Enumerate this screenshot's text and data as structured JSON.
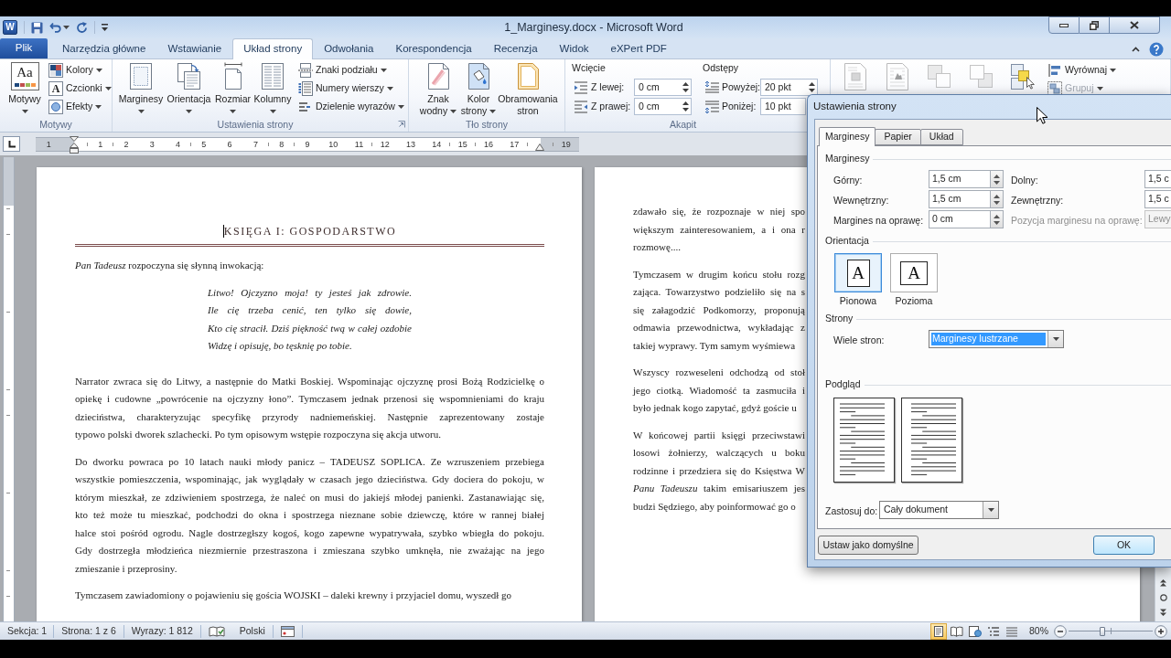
{
  "title_bar": {
    "app_icon_glyph": "W",
    "title": "1_Marginesy.docx - Microsoft Word"
  },
  "ribbon_tabs": [
    {
      "label": "Plik",
      "kind": "backstage",
      "selected": false
    },
    {
      "label": "Narzędzia główne",
      "kind": "tab",
      "selected": false
    },
    {
      "label": "Wstawianie",
      "kind": "tab",
      "selected": false
    },
    {
      "label": "Układ strony",
      "kind": "tab",
      "selected": true
    },
    {
      "label": "Odwołania",
      "kind": "tab",
      "selected": false
    },
    {
      "label": "Korespondencja",
      "kind": "tab",
      "selected": false
    },
    {
      "label": "Recenzja",
      "kind": "tab",
      "selected": false
    },
    {
      "label": "Widok",
      "kind": "tab",
      "selected": false
    },
    {
      "label": "eXPert PDF",
      "kind": "tab",
      "selected": false
    }
  ],
  "ribbon": {
    "themes": {
      "label": "Motywy",
      "launcher": false,
      "button": {
        "label": "Motywy",
        "icon_glyph": "Aa",
        "dropdown": true
      },
      "options": [
        {
          "label": "Kolory",
          "dropdown": true
        },
        {
          "label": "Czcionki",
          "icon_glyph": "A",
          "dropdown": true
        },
        {
          "label": "Efekty",
          "dropdown": true
        }
      ]
    },
    "page_setup": {
      "label": "Ustawienia strony",
      "launcher": true,
      "buttons": [
        {
          "label": "Marginesy",
          "dropdown": true
        },
        {
          "label": "Orientacja",
          "dropdown": true
        },
        {
          "label": "Rozmiar",
          "dropdown": true
        },
        {
          "label": "Kolumny",
          "dropdown": true
        }
      ],
      "options": [
        {
          "label": "Znaki podziału",
          "dropdown": true
        },
        {
          "label": "Numery wierszy",
          "dropdown": true
        },
        {
          "label": "Dzielenie wyrazów",
          "dropdown": true
        }
      ]
    },
    "page_background": {
      "label": "Tło strony",
      "launcher": false,
      "buttons": [
        {
          "label": "Znak wodny",
          "dropdown": true
        },
        {
          "label": "Kolor strony",
          "dropdown": true
        },
        {
          "label": "Obramowania stron",
          "dropdown": false
        }
      ]
    },
    "paragraph": {
      "label": "Akapit",
      "columns": [
        {
          "heading": "Wcięcie",
          "fields": [
            {
              "label": "Z lewej:",
              "value": "0 cm"
            },
            {
              "label": "Z prawej:",
              "value": "0 cm"
            }
          ]
        },
        {
          "heading": "Odstępy",
          "fields": [
            {
              "label": "Powyżej:",
              "value": "20 pkt"
            },
            {
              "label": "Poniżej:",
              "value": "10 pkt"
            }
          ]
        }
      ]
    },
    "arrange": {
      "icon_buttons": [
        {
          "disabled": true
        },
        {
          "disabled": true
        },
        {
          "disabled": true
        },
        {
          "disabled": true
        },
        {
          "disabled": false
        }
      ],
      "options": [
        {
          "label": "Wyrównaj",
          "dropdown": true,
          "disabled": false
        },
        {
          "label": "Grupuj",
          "dropdown": true,
          "disabled": true
        }
      ]
    }
  },
  "ruler": {
    "left_margin_label": "1",
    "labels": [
      "1",
      "2",
      "3",
      "4",
      "5",
      "6",
      "7",
      "8",
      "9",
      "10",
      "11",
      "12",
      "13",
      "14",
      "15",
      "16",
      "17"
    ],
    "right_margin_label": "19"
  },
  "document": {
    "pages": [
      {
        "heading": "KSIĘGA I: GOSPODARSTWO",
        "blocks": [
          {
            "kind": "text",
            "lines": [
              "*Pan Tadeusz* rozpoczyna się słynną inwokacją:"
            ]
          },
          {
            "kind": "poem",
            "lines": [
              "Litwo! Ojczyzno moja! ty jesteś jak zdrowie.",
              "Ile cię trzeba cenić, ten tylko się dowie,",
              "Kto cię stracił. Dziś piękność twą w całej ozdobie",
              "Widzę i opisuję, bo tęsknię po tobie."
            ]
          },
          {
            "kind": "text",
            "lines": [
              "Narrator zwraca się do Litwy, a następnie do Matki Boskiej. Wspominając ojczyznę prosi Bożą Rodzicielkę o",
              "opiekę i cudowne „powrócenie na ojczyzny łono”. Tymczasem jednak przenosi się wspomnieniami do kraju",
              "dzieciństwa, charakteryzując specyfikę przyrody nadniemeńskiej. Następnie zaprezentowany zostaje",
              "typowo polski dworek szlachecki. Po tym opisowym wstępie rozpoczyna się akcja utworu."
            ]
          },
          {
            "kind": "text",
            "lines": [
              "Do dworku powraca po 10 latach nauki młody panicz – TADEUSZ SOPLICA. Ze wzruszeniem przebiega",
              "wszystkie pomieszczenia, wspominając, jak wyglądały w czasach jego dzieciństwa. Gdy dociera do pokoju, w",
              "którym mieszkał, ze zdziwieniem spostrzega, że naleć on musi do jakiejś młodej panienki. Zastanawiając się,",
              "kto też może tu mieszkać, podchodzi do okna i spostrzega nieznane sobie dziewczę, które w rannej białej",
              "halce stoi pośród ogrodu. Nagle dostrzegłszy kogoś, kogo zapewne wypatrywała, szybko wbiegła do pokoju.",
              "Gdy dostrzegła młodzieńca niezmiernie przestraszona i zmieszana szybko umknęła, nie zważając na jego",
              "zmieszanie i przeprosiny."
            ]
          },
          {
            "kind": "text",
            "lines": [
              "Tymczasem zawiadomiony o pojawieniu się gościa WOJSKI – daleki krewny i przyjaciel domu, wyszedł go"
            ]
          }
        ]
      },
      {
        "blocks": [
          {
            "kind": "text",
            "lines": [
              "zdawało się, że rozpoznaje w niej spo",
              "większym zainteresowaniem, a i ona r",
              "rozmowę...."
            ]
          },
          {
            "kind": "text",
            "lines": [
              "Tymczasem w drugim końcu stołu rozg",
              "zająca. Towarzystwo podzieliło się na s",
              "się załagodzić Podkomorzy, proponują",
              "odmawia przewodnictwa, wykładając z",
              "takiej wyprawy. Tym samym wyśmiewa"
            ]
          },
          {
            "kind": "text",
            "lines": [
              "Wszyscy rozweseleni odchodzą od stoł",
              "jego ciotką. Wiadomość ta zasmuciła i",
              "było jednak kogo zapytać, gdyż goście u"
            ]
          },
          {
            "kind": "text",
            "lines": [
              "W końcowej partii księgi przeciwstawi",
              "losowi żołnierzy, walczących u boku",
              "rodzinne i przedziera się do Księstwa W",
              "*Panu Tadeuszu* takim emisariuszem jes",
              "budzi Sędziego, aby poinformować go o"
            ]
          }
        ]
      }
    ]
  },
  "status_bar": {
    "section": "Sekcja: 1",
    "page": "Strona: 1 z 6",
    "words": "Wyrazy: 1 812",
    "language": "Polski",
    "views": [
      {
        "selected": true
      },
      {
        "selected": false
      },
      {
        "selected": false
      },
      {
        "selected": false
      },
      {
        "selected": false
      }
    ],
    "zoom": {
      "label": "80%",
      "level": 0.4
    }
  },
  "dialog": {
    "title": "Ustawienia strony",
    "tabs": [
      {
        "label": "Marginesy",
        "selected": true
      },
      {
        "label": "Papier",
        "selected": false
      },
      {
        "label": "Układ",
        "selected": false
      }
    ],
    "margins": {
      "label": "Marginesy",
      "fields": [
        {
          "label": "Górny:",
          "value": "1,5 cm",
          "disabled": false
        },
        {
          "label": "Dolny:",
          "value": "1,5 c",
          "disabled": false
        },
        {
          "label": "Wewnętrzny:",
          "value": "1,5 cm",
          "disabled": false
        },
        {
          "label": "Zewnętrzny:",
          "value": "1,5 c",
          "disabled": false
        },
        {
          "label": "Margines na oprawę:",
          "value": "0 cm",
          "disabled": false
        },
        {
          "label": "Pozycja marginesu na oprawę:",
          "value": "Lewy",
          "disabled": true
        }
      ]
    },
    "orientation": {
      "label": "Orientacja",
      "options": [
        {
          "label": "Pionowa",
          "glyph": "A",
          "kind": "portrait",
          "selected": true
        },
        {
          "label": "Pozioma",
          "glyph": "A",
          "kind": "landscape",
          "selected": false
        }
      ]
    },
    "pages": {
      "label": "Strony",
      "field": {
        "label": "Wiele stron:",
        "value": "Marginesy lustrzane",
        "focused": true
      }
    },
    "preview": {
      "label": "Podgląd"
    },
    "apply_to": {
      "label": "Zastosuj do:",
      "value": "Cały dokument"
    },
    "buttons": [
      {
        "label": "Ustaw jako domyślne",
        "default": false
      },
      {
        "label": "OK",
        "default": true
      }
    ]
  }
}
